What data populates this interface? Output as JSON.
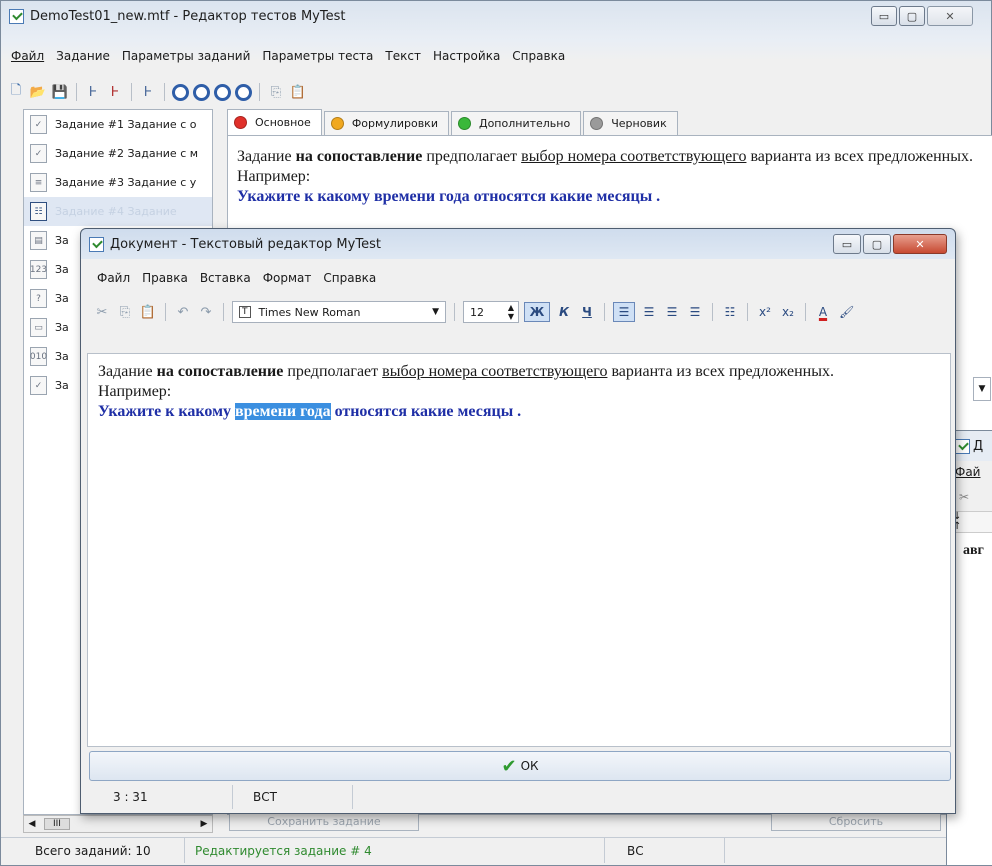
{
  "main_window": {
    "title": "DemoTest01_new.mtf - Редактор тестов MyTest",
    "menu": [
      "Файл",
      "Задание",
      "Параметры заданий",
      "Параметры теста",
      "Текст",
      "Настройка",
      "Справка"
    ],
    "tasks": [
      "Задание #1 Задание с о",
      "Задание #2 Задание с м",
      "Задание #3 Задание с у",
      "Задание #4 Задание",
      "За",
      "За",
      "За",
      "За",
      "За",
      "За"
    ],
    "tabs": [
      {
        "label": "Основное",
        "color": "#e0302a"
      },
      {
        "label": "Формулировки",
        "color": "#f0a820"
      },
      {
        "label": "Дополнительно",
        "color": "#3ab83a"
      },
      {
        "label": "Черновик",
        "color": "#9a9a9a"
      }
    ],
    "content": {
      "p1_a": "Задание ",
      "p1_b": "на сопоставление",
      "p1_c": " предполагает ",
      "p1_d": "выбор номера соответствующего",
      "p1_e": " варианта из всех предложенных. Например:",
      "p2": "Укажите к какому времени года относятся какие месяцы ."
    },
    "bottom_buttons": [
      "Сохранить задание",
      "Сбросить"
    ],
    "scroll_label": "III",
    "status": {
      "total": "Всего заданий: 10",
      "editing": "Редактируется задание # 4",
      "mode": "ВС"
    }
  },
  "editor_window": {
    "title": "Документ - Текстовый редактор MyTest",
    "menu": [
      "Файл",
      "Правка",
      "Вставка",
      "Формат",
      "Справка"
    ],
    "font_name": "Times New Roman",
    "font_size": "12",
    "bold_label": "Ж",
    "italic_label": "К",
    "underline_label": "Ч",
    "content": {
      "p1_a": "Задание ",
      "p1_b": "на сопоставление",
      "p1_c": " предполагает ",
      "p1_d": "выбор номера соответствующего",
      "p1_e": " варианта из всех предложенных. Например:",
      "p2_a": "Укажите к какому ",
      "p2_sel": "времени года",
      "p2_b": " относятся какие месяцы ."
    },
    "ok_label": "ОК",
    "status": {
      "position": "3 : 31",
      "mode": "ВСТ"
    }
  },
  "third_window": {
    "title": "Д",
    "menu": "Фай",
    "content": "авг"
  }
}
